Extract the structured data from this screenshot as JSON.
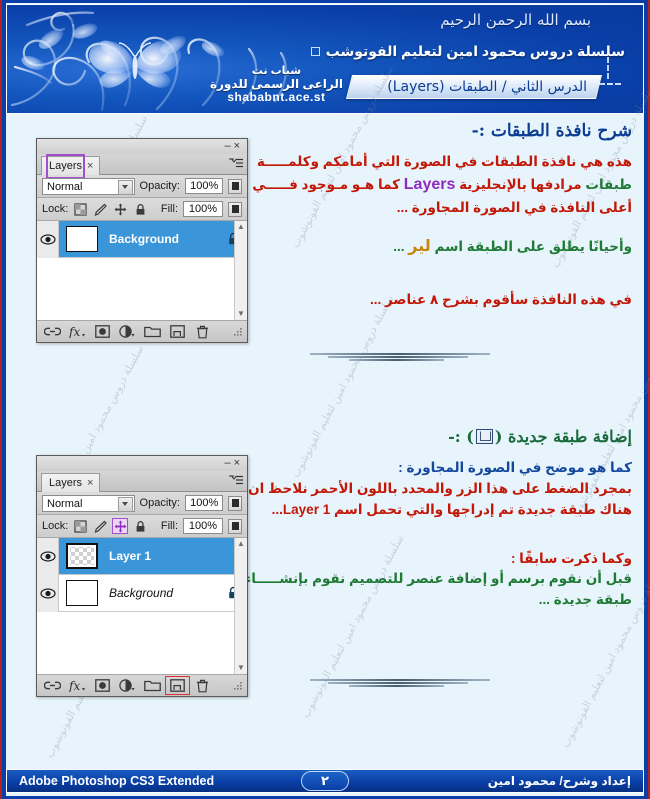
{
  "header": {
    "bismillah": "بسم الله الرحمن الرحيم",
    "series_line": "سلسلة دروس محمود امين لتعليم الفوتوشب",
    "lesson_title": "الدرس الثاني /  الطبقات (Layers)",
    "sponsor_name": "شباب نت",
    "sponsor_role": "الراعى الرسمى للدورة",
    "sponsor_url": "shababnt.ace.st"
  },
  "watermark": {
    "text": "سلسلة دروس محمود امين لتعليم الفوتوشوب"
  },
  "section1": {
    "heading": "شرح نافذة الطبقات :-",
    "line1": "هذه هي نافذة الطبقات في الصورة التي أمامكم وكلمـــــة",
    "line2_a": "طبقات",
    "line2_b": " مرادفها بالإنجليزية ",
    "line2_c": "Layers",
    "line2_d": " كما هـو مـوجود فـــــي",
    "line3": "أعلى النافذة في الصورة المجاورة ...",
    "line4_a": "وأحيانًا يطلق على الطبقة اسم ",
    "line4_b": "لير",
    "line4_c": " ...",
    "line5": "في هذه النافذة سأقوم بشرح ٨ عناصر ..."
  },
  "section2": {
    "heading_before": "إضافة طبقة جديدة (",
    "heading_after": ") :-",
    "line1": "كما هو موضح في الصورة المجاورة :",
    "line2": "بمجرد الضغط على هذا الزر والمحدد باللون الأحمر نلاحظ ان",
    "line3": "هناك طبقة جديدة تم إدراجها والتي تحمل اسم Layer 1...",
    "line4": "وكما ذكرت  سابقًا :",
    "line5": "قبل أن نقوم برسم أو إضافة عنصر للتصميم نقوم بإنشـــــاء",
    "line6": "طبقة جديدة ..."
  },
  "panel1": {
    "tab_label": "Layers",
    "tab_close": "×",
    "minimize": "–",
    "close": "×",
    "blend_mode": "Normal",
    "opacity_label": "Opacity:",
    "opacity_value": "100%",
    "lock_label": "Lock:",
    "fill_label": "Fill:",
    "fill_value": "100%",
    "lock_icons": [
      "lock-transparent-pixels-icon",
      "lock-image-pixels-icon",
      "lock-position-icon",
      "lock-all-icon"
    ],
    "layers": [
      {
        "name": "Background",
        "visible": true,
        "locked": true,
        "selected": true,
        "thumb": "white"
      }
    ],
    "bottom_buttons": [
      "link-layers-icon",
      "layer-styles-icon",
      "layer-mask-icon",
      "adjustment-layer-icon",
      "new-group-icon",
      "new-layer-icon",
      "delete-layer-icon"
    ]
  },
  "panel2": {
    "tab_label": "Layers",
    "tab_close": "×",
    "minimize": "–",
    "close": "×",
    "blend_mode": "Normal",
    "opacity_label": "Opacity:",
    "opacity_value": "100%",
    "lock_label": "Lock:",
    "fill_label": "Fill:",
    "fill_value": "100%",
    "layers": [
      {
        "name": "Layer 1",
        "visible": true,
        "locked": false,
        "selected": true,
        "thumb": "transparent"
      },
      {
        "name": "Background",
        "visible": true,
        "locked": true,
        "selected": false,
        "thumb": "white"
      }
    ]
  },
  "footer": {
    "app_name": "Adobe Photoshop CS3 Extended",
    "page_number": "٢",
    "author": "إعداد وشرح/ محمود امين"
  },
  "colors": {
    "banner_blue": "#0a3fa8",
    "page_bg": "#e8f4fc",
    "text_red": "#c21807",
    "text_green": "#1e7a35",
    "text_blue": "#13489e",
    "heading_blue": "#0b3d91",
    "heading_green": "#186a3b",
    "highlight_purple": "#a24fc9",
    "highlight_red": "#e03131",
    "layer_selected": "#3a95d9"
  }
}
